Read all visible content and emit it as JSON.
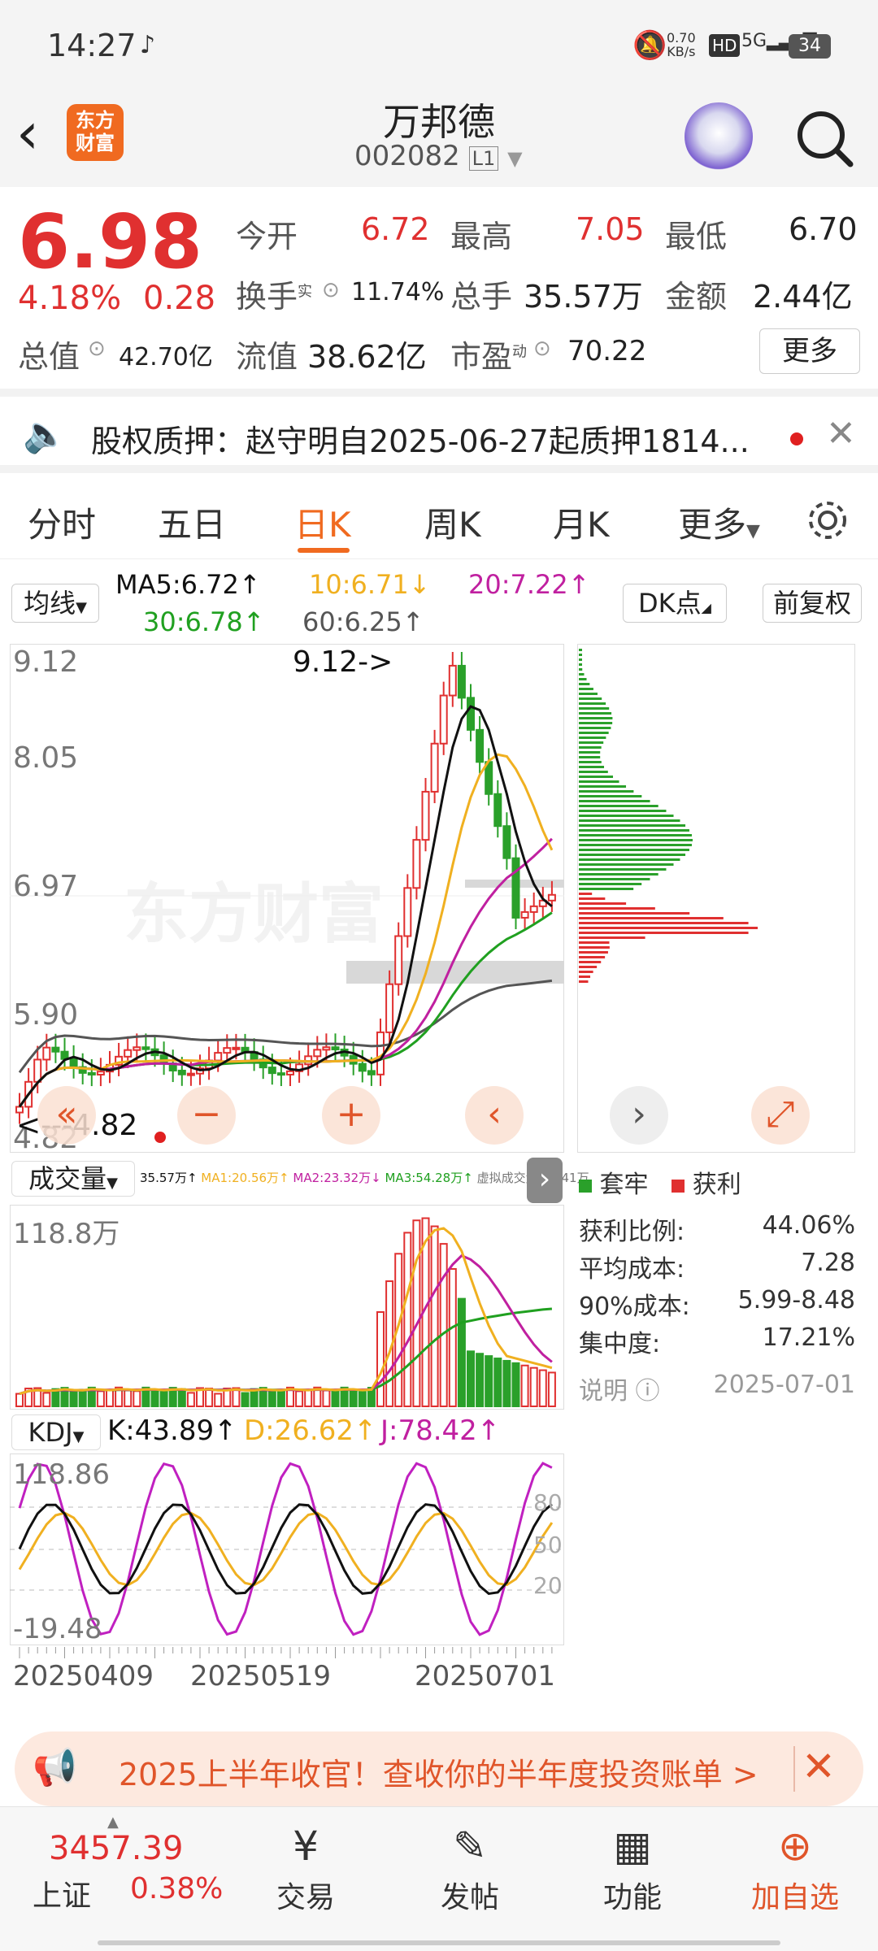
{
  "status": {
    "time": "14:27",
    "net_speed": "0.70\nKB/s",
    "battery": "34",
    "hd": "HD",
    "signal": "5G"
  },
  "header": {
    "brand_line1": "东方",
    "brand_line2": "财富",
    "stock_name": "万邦德",
    "stock_code": "002082",
    "level": "L1"
  },
  "quote": {
    "price": "6.98",
    "change_pct": "4.18%",
    "change": "0.28",
    "open_label": "今开",
    "open": "6.72",
    "high_label": "最高",
    "high": "7.05",
    "low_label": "最低",
    "low": "6.70",
    "turnover_label": "换手",
    "turnover_sup": "实",
    "turnover": "11.74%",
    "volume_label": "总手",
    "volume": "35.57万",
    "amount_label": "金额",
    "amount": "2.44亿",
    "mcap_label": "总值",
    "mcap": "42.70亿",
    "float_label": "流值",
    "float_mcap": "38.62亿",
    "pe_label": "市盈",
    "pe_sup": "动",
    "pe": "70.22",
    "more": "更多"
  },
  "notice": {
    "text": "股权质押：赵守明自2025-06-27起质押1814..."
  },
  "tabs": [
    "分时",
    "五日",
    "日K",
    "周K",
    "月K",
    "更多"
  ],
  "active_tab": 2,
  "ma": {
    "select": "均线",
    "ma5": "MA5:6.72↑",
    "ma10": "10:6.71↓",
    "ma20": "20:7.22↑",
    "ma30": "30:6.78↑",
    "ma60": "60:6.25↑",
    "dk": "DK点",
    "adj": "前复权"
  },
  "kchart": {
    "y_labels": [
      "9.12",
      "8.05",
      "6.97",
      "5.90",
      "4.82"
    ],
    "max_mark": "9.12->",
    "min_mark": "<---4.82"
  },
  "vol": {
    "select": "成交量",
    "legend_vol": "35.57万↑",
    "legend_ma1": "MA1:20.56万↑",
    "legend_ma2": "MA2:23.32万↓",
    "legend_ma3": "MA3:54.28万↑",
    "legend_virtual": "虚拟成交量:40.41万",
    "max_label": "118.8万"
  },
  "kdj": {
    "select": "KDJ",
    "k": "K:43.89↑",
    "d": "D:26.62↑",
    "j": "J:78.42↑",
    "top": "118.86",
    "bottom": "-19.48",
    "l80": "80",
    "l50": "50",
    "l20": "20"
  },
  "dates": [
    "20250409",
    "20250519",
    "20250701"
  ],
  "chips": {
    "legend_trap": "套牢",
    "legend_profit": "获利",
    "rows": [
      {
        "label": "获利比例:",
        "value": "44.06%"
      },
      {
        "label": "平均成本:",
        "value": "7.28"
      },
      {
        "label": "90%成本:",
        "value": "5.99-8.48"
      },
      {
        "label": "集中度:",
        "value": "17.21%"
      }
    ],
    "note_label": "说明",
    "date": "2025-07-01"
  },
  "banner": {
    "text": "2025上半年收官！查收你的半年度投资账单 >"
  },
  "bottom": {
    "index_value": "3457.39",
    "index_name": "上证",
    "index_change": "0.38%",
    "items": [
      "交易",
      "发帖",
      "功能",
      "加自选"
    ]
  },
  "colors": {
    "up": "#e03030",
    "down": "#2aa02a",
    "ma5": "#111111",
    "ma10": "#f0b020",
    "ma20": "#c020a0",
    "ma30": "#20a020",
    "ma60": "#555555",
    "accent": "#f06a20"
  }
}
